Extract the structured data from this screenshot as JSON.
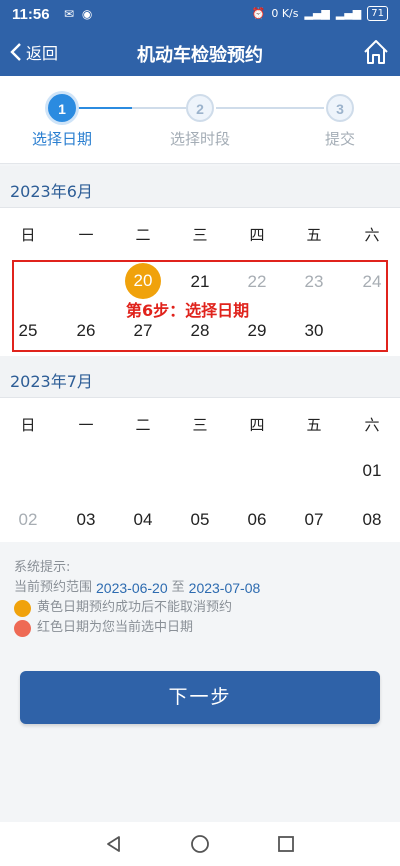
{
  "status_bar": {
    "time": "11:56",
    "net_speed": "0 K/s",
    "battery": "71"
  },
  "nav": {
    "back_label": "返回",
    "title": "机动车检验预约"
  },
  "stepper": [
    {
      "num": "1",
      "label": "选择日期",
      "active": true
    },
    {
      "num": "2",
      "label": "选择时段",
      "active": false
    },
    {
      "num": "3",
      "label": "提交",
      "active": false
    }
  ],
  "weekdays": [
    "日",
    "一",
    "二",
    "三",
    "四",
    "五",
    "六"
  ],
  "june": {
    "title": "2023年6月",
    "row1": [
      "20",
      "21",
      "22",
      "23",
      "24"
    ],
    "row2": [
      "25",
      "26",
      "27",
      "28",
      "29",
      "30"
    ]
  },
  "july": {
    "title": "2023年7月",
    "row1": [
      "01"
    ],
    "row2": [
      "02",
      "03",
      "04",
      "05",
      "06",
      "07",
      "08"
    ]
  },
  "annotation": "第6步：选择日期",
  "tips": {
    "title": "系统提示:",
    "range_prefix": "当前预约范围",
    "range_start": "2023-06-20",
    "range_sep": "至",
    "range_end": "2023-07-08",
    "legend_yellow": "黄色日期预约成功后不能取消预约",
    "legend_red": "红色日期为您当前选中日期"
  },
  "next_button": "下一步",
  "colors": {
    "primary": "#2f62a8",
    "selected": "#f0a20c",
    "current": "#ee6a55",
    "annotation": "#e0231c"
  }
}
